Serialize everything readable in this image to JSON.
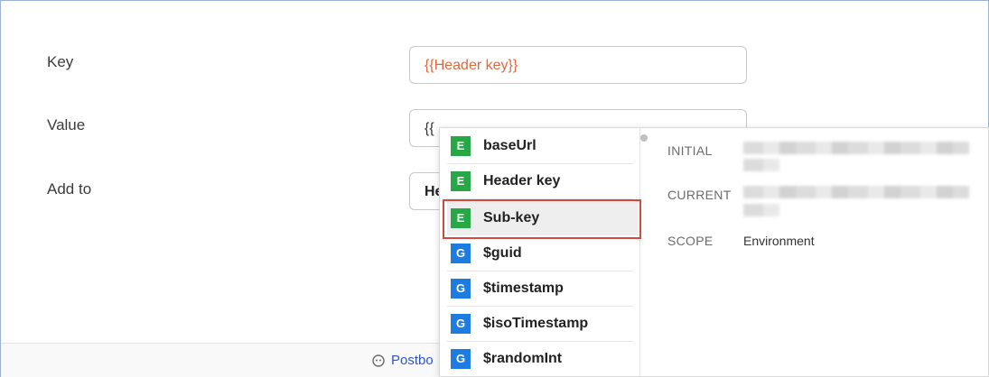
{
  "form": {
    "key_label": "Key",
    "key_value": "{{Header key}}",
    "value_label": "Value",
    "value_value": "{{",
    "addto_label": "Add to",
    "addto_value": "He"
  },
  "footer": {
    "link_label": "Postbo"
  },
  "autocomplete": {
    "items": [
      {
        "badge": "E",
        "label": "baseUrl"
      },
      {
        "badge": "E",
        "label": "Header key"
      },
      {
        "badge": "E",
        "label": "Sub-key"
      },
      {
        "badge": "G",
        "label": "$guid"
      },
      {
        "badge": "G",
        "label": "$timestamp"
      },
      {
        "badge": "G",
        "label": "$isoTimestamp"
      },
      {
        "badge": "G",
        "label": "$randomInt"
      }
    ],
    "selected_index": 2,
    "detail": {
      "initial_label": "INITIAL",
      "current_label": "CURRENT",
      "scope_label": "SCOPE",
      "scope_value": "Environment"
    }
  },
  "colors": {
    "environment_badge": "#27a745",
    "global_badge": "#1e7be0",
    "highlight_border": "#d04b3e",
    "variable_text": "#e0673c"
  }
}
